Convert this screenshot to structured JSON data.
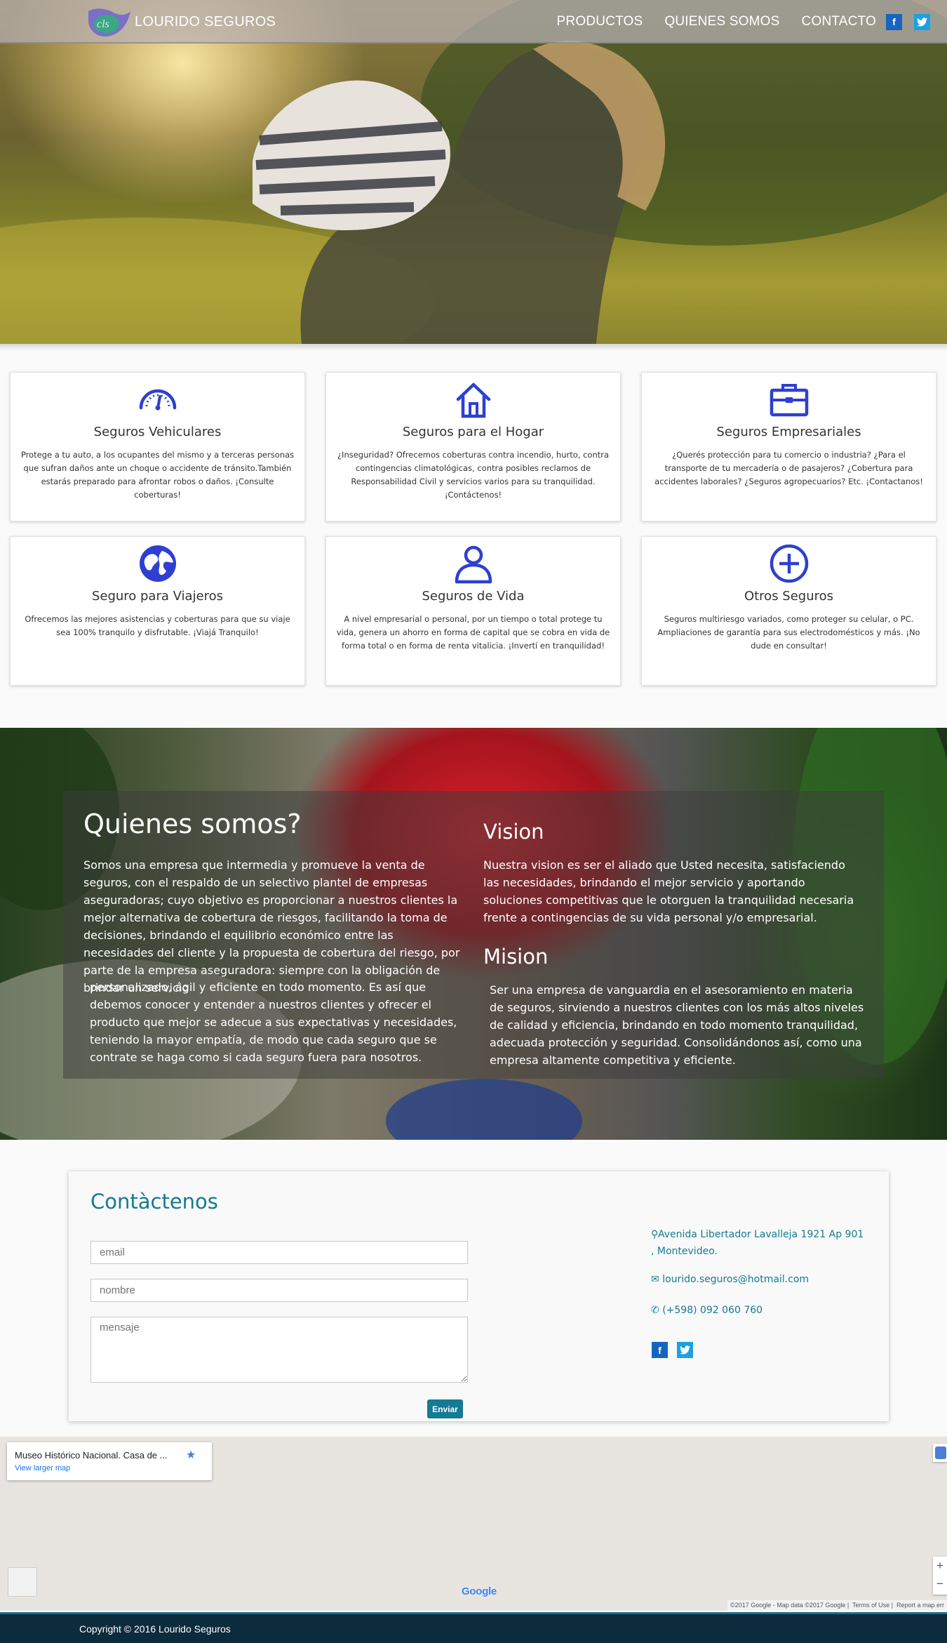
{
  "brand": {
    "name": "LOURIDO SEGUROS"
  },
  "nav": {
    "items": [
      "PRODUCTOS",
      "QUIENES SOMOS",
      "CONTACTO"
    ],
    "facebook": "f",
    "twitter": "t"
  },
  "cards": [
    {
      "title": "Seguros Vehiculares",
      "text": "Protege a tu auto, a los ocupantes del mismo y a terceras personas que sufran daños ante un choque o accidente de tránsito.También estarás preparado para afrontar robos o daños. ¡Consulte coberturas!",
      "icon": "speedometer-icon"
    },
    {
      "title": "Seguros para el Hogar",
      "text": "¿Inseguridad? Ofrecemos coberturas contra incendio, hurto, contra contingencias climatológicas, contra posibles reclamos de Responsabilidad Civil y servicios varios para su tranquilidad. ¡Contáctenos!",
      "icon": "home-icon"
    },
    {
      "title": "Seguros Empresariales",
      "text": "¿Querés protección para tu comercio o industria? ¿Para el transporte de tu mercadería o de pasajeros? ¿Cobertura para accidentes laborales? ¿Seguros agropecuarios? Etc. ¡Contactanos!",
      "icon": "briefcase-icon"
    },
    {
      "title": "Seguro para Viajeros",
      "text": "Ofrecemos las mejores asistencias y coberturas para que su viaje sea 100% tranquilo y disfrutable. ¡Viajá Tranquilo!",
      "icon": "globe-icon"
    },
    {
      "title": "Seguros de Vida",
      "text": "A nivel empresarial o personal, por un tiempo o total protege tu vida, genera un ahorro en forma de capital que se cobra en vida de forma total o en forma de renta vitalicia. ¡Invertí en tranquilidad!",
      "icon": "person-icon"
    },
    {
      "title": "Otros Seguros",
      "text": "Seguros multiriesgo variados, como proteger su celular, o PC. Ampliaciones de garantía para sus electrodomésticos y más. ¡No dude en consultar!",
      "icon": "plus-circle-icon"
    }
  ],
  "about": {
    "title": "Quienes somos?",
    "text1": "Somos una empresa que intermedia y promueve la venta de seguros, con el respaldo de un selectivo plantel de empresas aseguradoras; cuyo objetivo es proporcionar a nuestros clientes la mejor alternativa de cobertura de riesgos, facilitando la toma de decisiones, brindando el equilibrio económico entre las necesidades del cliente y la propuesta de cobertura del riesgo, por parte de la empresa aseguradora: siempre con la obligación de brindar un servicio",
    "text2": "personalizado, ágil y eficiente en todo momento. Es así que debemos conocer y entender a nuestros clientes y ofrecer el producto que mejor se adecue a sus expectativas y necesidades, teniendo la mayor empatía, de modo que cada seguro que se contrate se haga como si cada seguro fuera para nosotros.",
    "vision_title": "Vision",
    "vision_text": "Nuestra vision es ser el aliado que Usted necesita, satisfaciendo las necesidades, brindando el mejor servicio y aportando soluciones competitivas que le otorguen la tranquilidad necesaria frente a contingencias de su vida personal y/o empresarial.",
    "mision_title": "Mision",
    "mision_text": "Ser una empresa de vanguardia en el asesoramiento en materia de seguros, sirviendo a nuestros clientes con los más altos niveles de calidad y eficiencia, brindando en todo momento tranquilidad, adecuada protección y seguridad. Consolidándonos así, como una empresa altamente competitiva y eficiente."
  },
  "contact": {
    "title": "Contàctenos",
    "email_placeholder": "email",
    "name_placeholder": "nombre",
    "message_placeholder": "mensaje",
    "send": "Enviar",
    "address": "Avenida Libertador Lavalleja 1921 Ap 901 , Montevideo.",
    "email": "lourido.seguros@hotmail.com",
    "phone": "(+598) 092 060 760"
  },
  "map": {
    "place": "Museo Histórico Nacional. Casa de ...",
    "larger": "View larger map",
    "logo": "Google",
    "attribution": "©2017 Google - Map data ©2017 Google",
    "terms": "Terms of Use",
    "report": "Report a map err",
    "zoom_in": "+",
    "zoom_out": "−"
  },
  "footer": {
    "copyright": "Copyright © 2016 Lourido Seguros"
  },
  "colors": {
    "accent": "#157a93",
    "icon": "#2e3fd1",
    "footer": "#0c2b3d"
  }
}
